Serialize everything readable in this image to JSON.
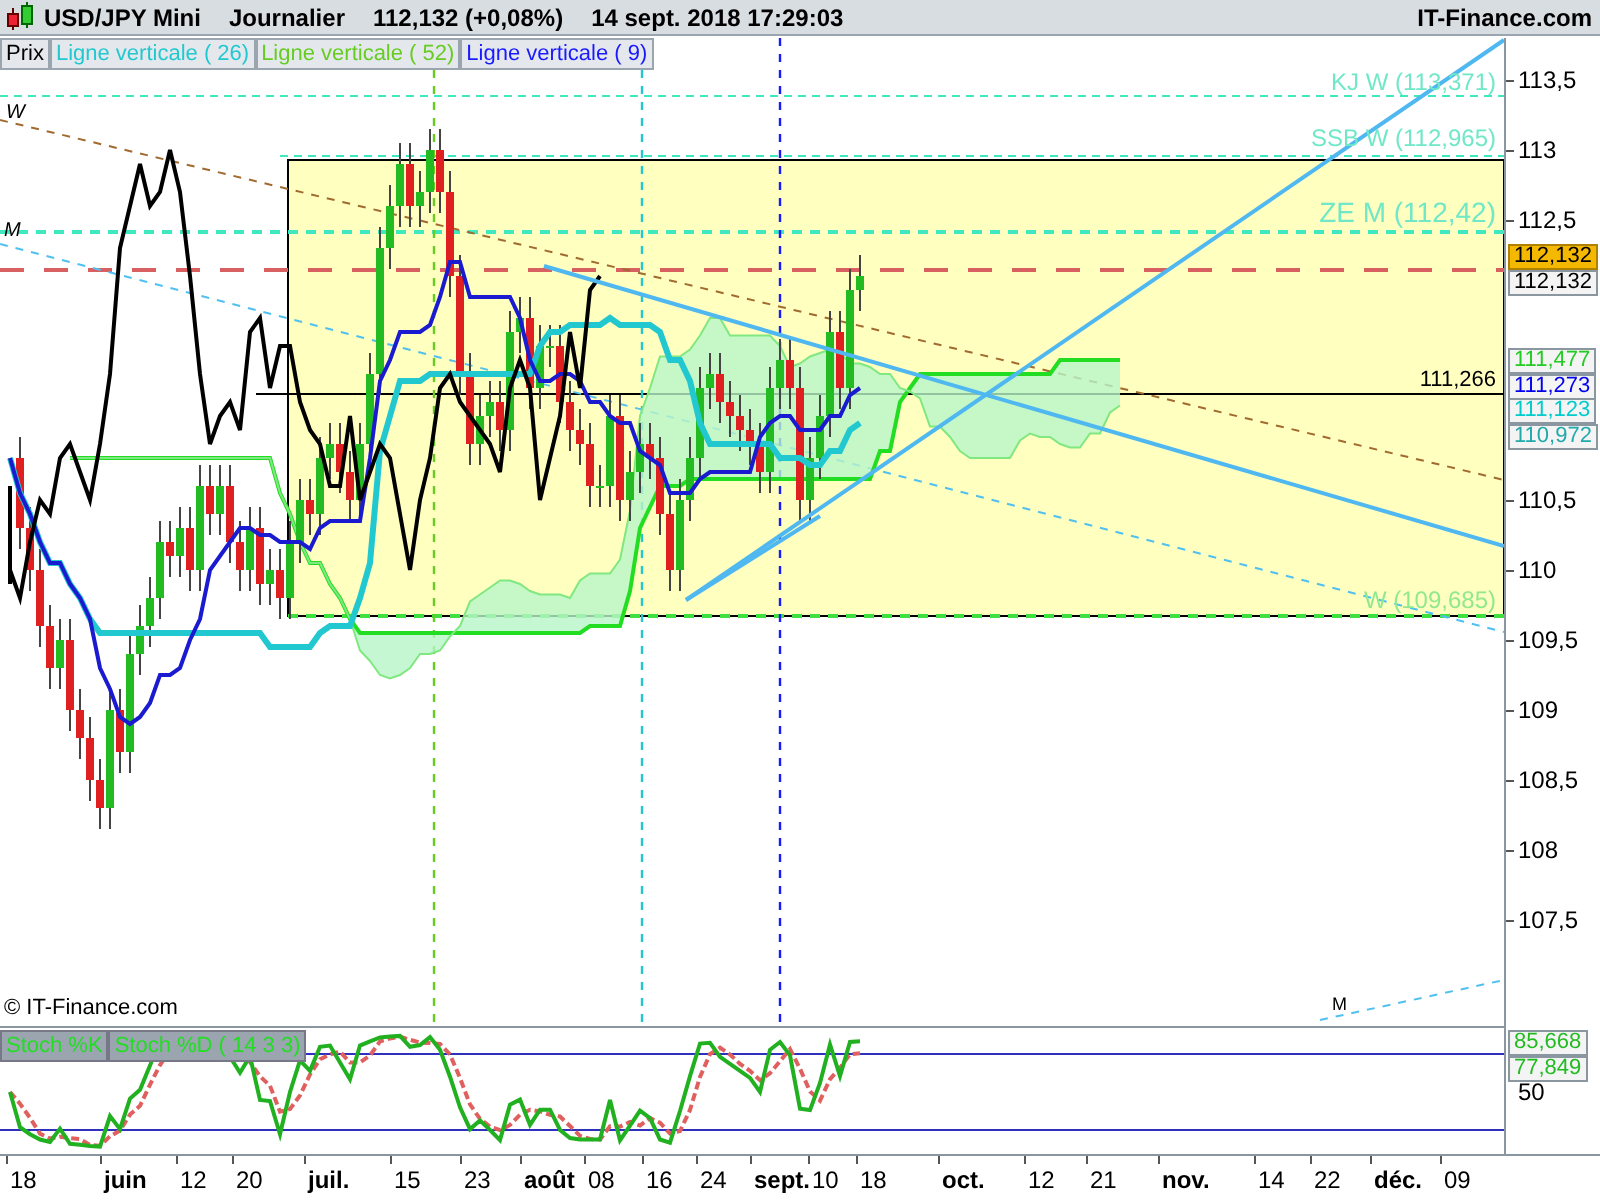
{
  "header": {
    "symbol": "USD/JPY Mini",
    "period": "Journalier",
    "price": "112,132 (+0,08%)",
    "datetime": "14 sept. 2018 17:29:03",
    "brand": "IT-Finance.com"
  },
  "legend": [
    {
      "label": "Prix",
      "color": "#000000"
    },
    {
      "label": "Ligne verticale ( 26)",
      "color": "#22c8d0"
    },
    {
      "label": "Ligne verticale ( 52)",
      "color": "#66cc22"
    },
    {
      "label": "Ligne verticale ( 9)",
      "color": "#1a1aff"
    }
  ],
  "line_labels": [
    "KJ W (113,371)",
    "SSB W (112,965)",
    "ZE M (112,42)",
    "111,266",
    "W (109,685)",
    "W",
    "M",
    "M"
  ],
  "price_axis": [
    "113,5",
    "113",
    "112,5",
    "110,5",
    "110",
    "109,5",
    "109",
    "108,5",
    "108",
    "107,5"
  ],
  "price_tags": [
    {
      "label": "112,132",
      "kind": "last",
      "color": "#f5b800"
    },
    {
      "label": "112,132",
      "kind": "line",
      "color": "#000000"
    },
    {
      "label": "111,477",
      "kind": "line",
      "color": "#22cc22"
    },
    {
      "label": "111,273",
      "kind": "line",
      "color": "#0000ee"
    },
    {
      "label": "111,123",
      "kind": "line",
      "color": "#00cccc"
    },
    {
      "label": "110,972",
      "kind": "line",
      "color": "#22aaaa"
    }
  ],
  "copyright": "© IT-Finance.com",
  "stoch": {
    "legend": [
      "Stoch %K",
      "Stoch %D ( 14 3 3)"
    ],
    "axis": [
      "50"
    ],
    "tags": [
      "85,668",
      "77,849"
    ]
  },
  "time_axis": [
    {
      "label": "18",
      "kind": "day"
    },
    {
      "label": "juin",
      "kind": "month"
    },
    {
      "label": "12",
      "kind": "day"
    },
    {
      "label": "20",
      "kind": "day"
    },
    {
      "label": "juil.",
      "kind": "month"
    },
    {
      "label": "15",
      "kind": "day"
    },
    {
      "label": "23",
      "kind": "day"
    },
    {
      "label": "août",
      "kind": "month"
    },
    {
      "label": "08",
      "kind": "day"
    },
    {
      "label": "16",
      "kind": "day"
    },
    {
      "label": "24",
      "kind": "day"
    },
    {
      "label": "sept.",
      "kind": "month"
    },
    {
      "label": "10",
      "kind": "day"
    },
    {
      "label": "18",
      "kind": "day"
    },
    {
      "label": "oct.",
      "kind": "month"
    },
    {
      "label": "12",
      "kind": "day"
    },
    {
      "label": "21",
      "kind": "day"
    },
    {
      "label": "nov.",
      "kind": "month"
    },
    {
      "label": "14",
      "kind": "day"
    },
    {
      "label": "22",
      "kind": "day"
    },
    {
      "label": "déc.",
      "kind": "month"
    },
    {
      "label": "09",
      "kind": "day"
    }
  ]
}
